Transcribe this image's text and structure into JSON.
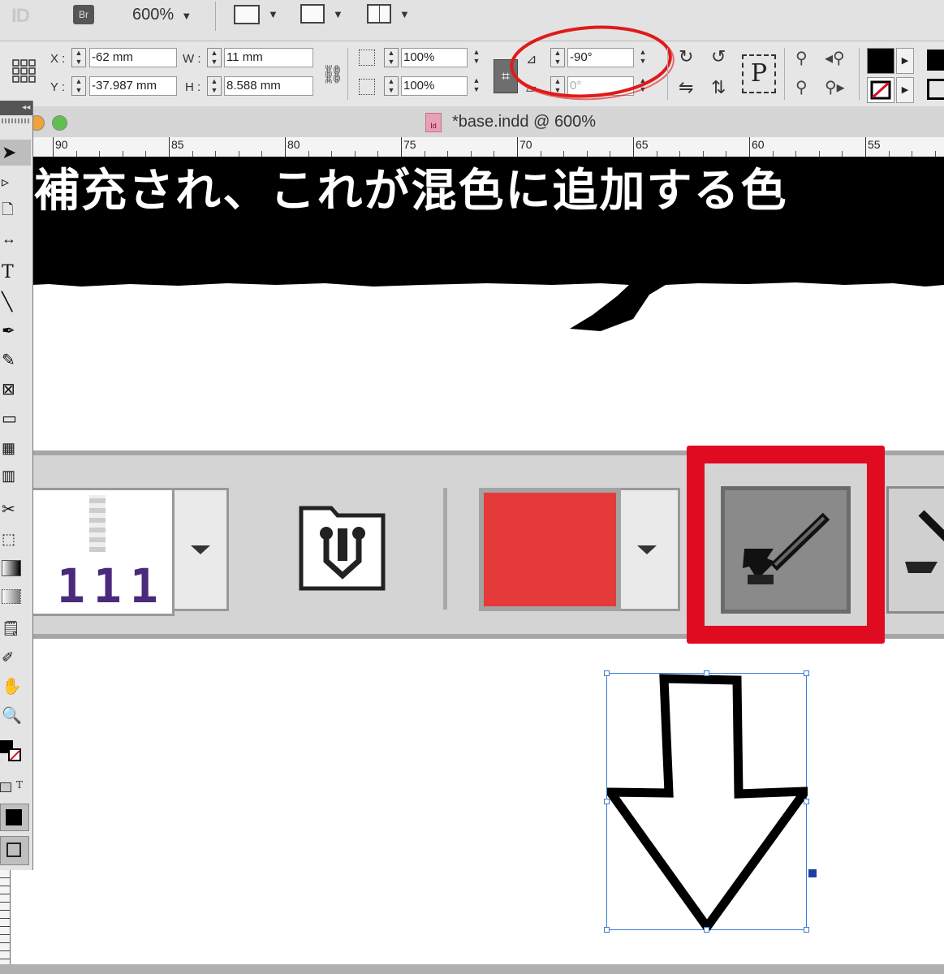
{
  "app_bar": {
    "logo": "ID",
    "bridge_label": "Br",
    "zoom_value": "600%"
  },
  "control_panel": {
    "x_label": "X :",
    "x_value": "-62 mm",
    "y_label": "Y :",
    "y_value": "-37.987 mm",
    "w_label": "W :",
    "w_value": "11 mm",
    "h_label": "H :",
    "h_value": "8.588 mm",
    "scale_x_value": "100%",
    "scale_y_value": "100%",
    "rotation_value": "-90°",
    "shear_value": "0°",
    "proxy_char": "P",
    "stroke_swatch_color": "#000000"
  },
  "document": {
    "title": "*base.indd @ 600%",
    "ruler_labels": [
      "90",
      "85",
      "80",
      "75",
      "70",
      "65",
      "60",
      "55"
    ],
    "banner_text": "補充され、これが混色に追加する色",
    "banner_color": "#000000"
  },
  "tools": {
    "items": [
      "selection-tool",
      "direct-selection-tool",
      "page-tool",
      "gap-tool",
      "type-tool",
      "line-tool",
      "pen-tool",
      "pencil-tool",
      "rectangle-frame-tool",
      "rectangle-tool",
      "table-tool",
      "table-tool-2",
      "scissors-tool",
      "free-transform-tool",
      "gradient-swatch-tool",
      "gradient-feather-tool",
      "note-tool",
      "eyedropper-tool",
      "hand-tool",
      "zoom-tool"
    ],
    "type_label": "T",
    "formatting_text_label": "T"
  },
  "big_panel": {
    "swatch_preview_text": "111",
    "swatch_color": "#e53a3a"
  },
  "annotation": {
    "highlight_color": "#e00b20",
    "note": "highlighted apply-color button"
  }
}
